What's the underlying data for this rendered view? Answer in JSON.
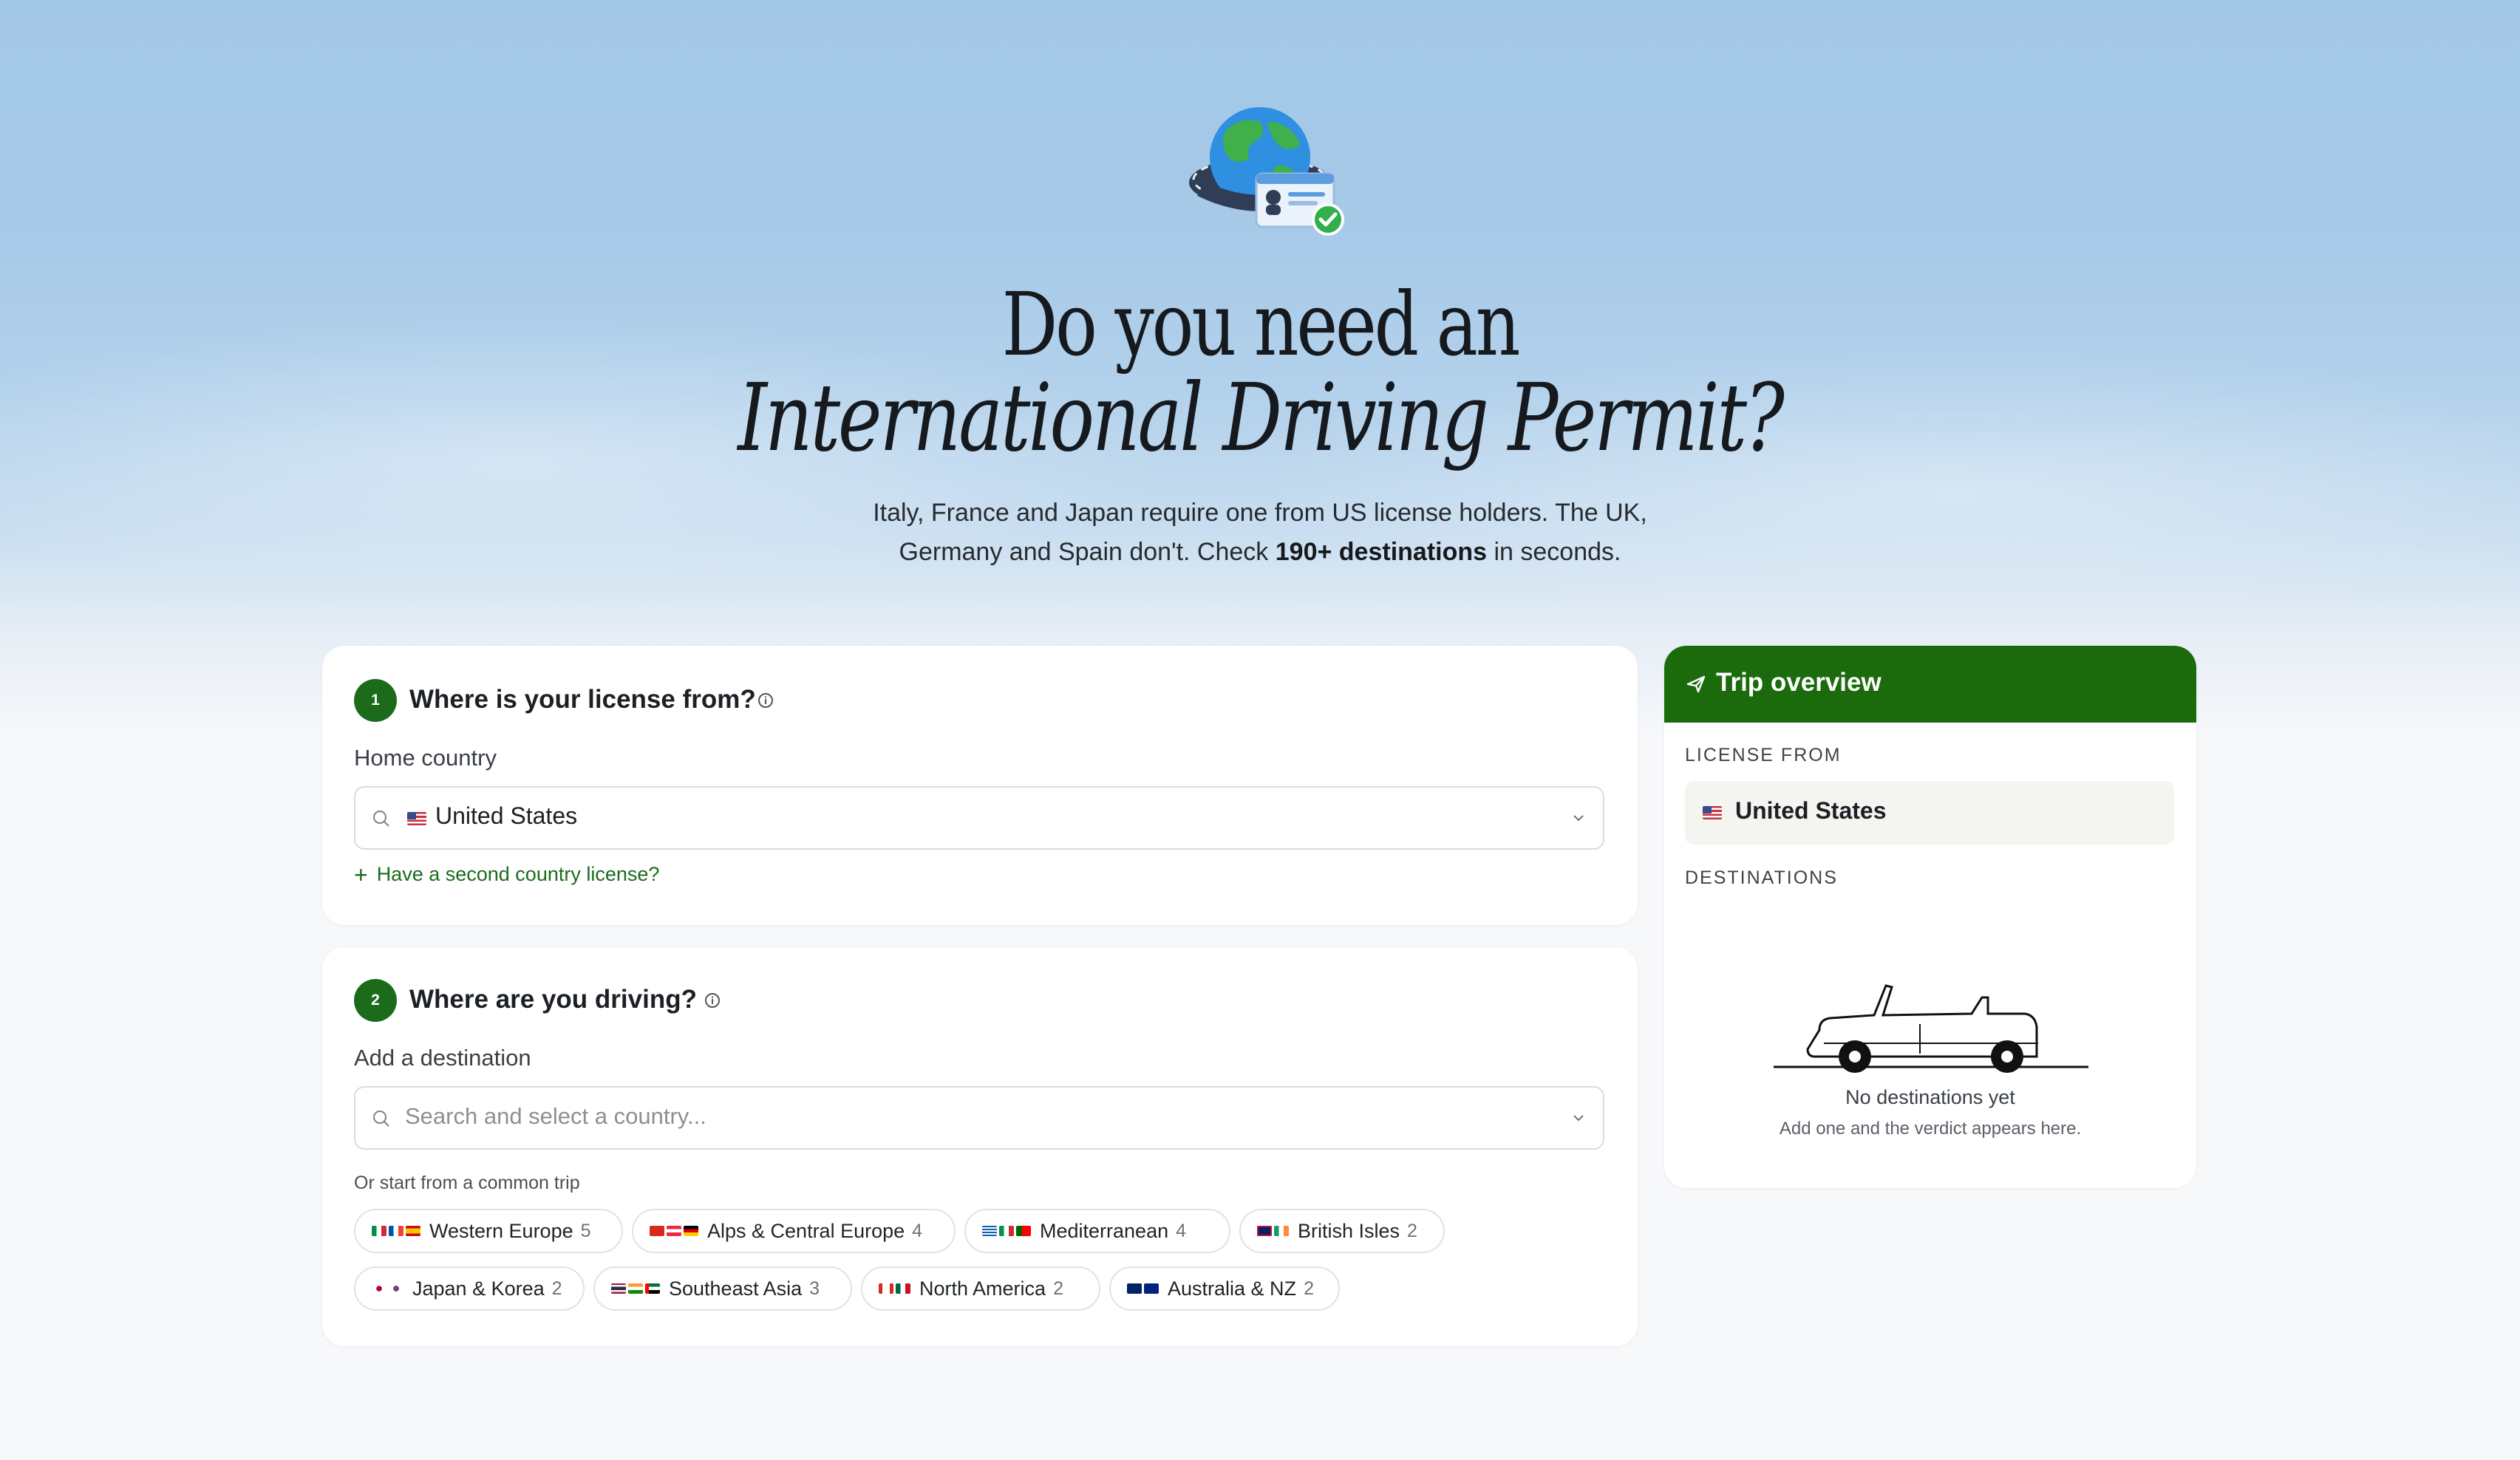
{
  "hero": {
    "icon": "globe-license-icon",
    "title_line1": "Do you need an",
    "title_line2": "International Driving Permit?",
    "subtitle_part1": "Italy, France and Japan require one from US license holders. The UK, Germany and Spain don't. Check ",
    "subtitle_bold": "190+ destinations",
    "subtitle_part2": " in seconds."
  },
  "license_card": {
    "step": "1",
    "title": "Where is your license from?",
    "field_label": "Home country",
    "selected_country": "United States",
    "second_license_link": "Have a second country license?"
  },
  "destination_card": {
    "step": "2",
    "title": "Where are you driving?",
    "field_label": "Add a destination",
    "placeholder": "Search and select a country...",
    "common_trips_label": "Or start from a common trip",
    "trips": [
      {
        "label": "Western Europe",
        "count": "5"
      },
      {
        "label": "Alps & Central Europe",
        "count": "4"
      },
      {
        "label": "Mediterranean",
        "count": "4"
      },
      {
        "label": "British Isles",
        "count": "2"
      },
      {
        "label": "Japan & Korea",
        "count": "2"
      },
      {
        "label": "Southeast Asia",
        "count": "3"
      },
      {
        "label": "North America",
        "count": "2"
      },
      {
        "label": "Australia & NZ",
        "count": "2"
      }
    ]
  },
  "trip_overview": {
    "title": "Trip overview",
    "license_from_label": "LICENSE FROM",
    "license_from_value": "United States",
    "destinations_label": "DESTINATIONS",
    "empty_title": "No destinations yet",
    "empty_subtitle": "Add one and the verdict appears here."
  },
  "colors": {
    "accent_green": "#1b6b0c",
    "sky_blue": "#a3c7e7"
  }
}
